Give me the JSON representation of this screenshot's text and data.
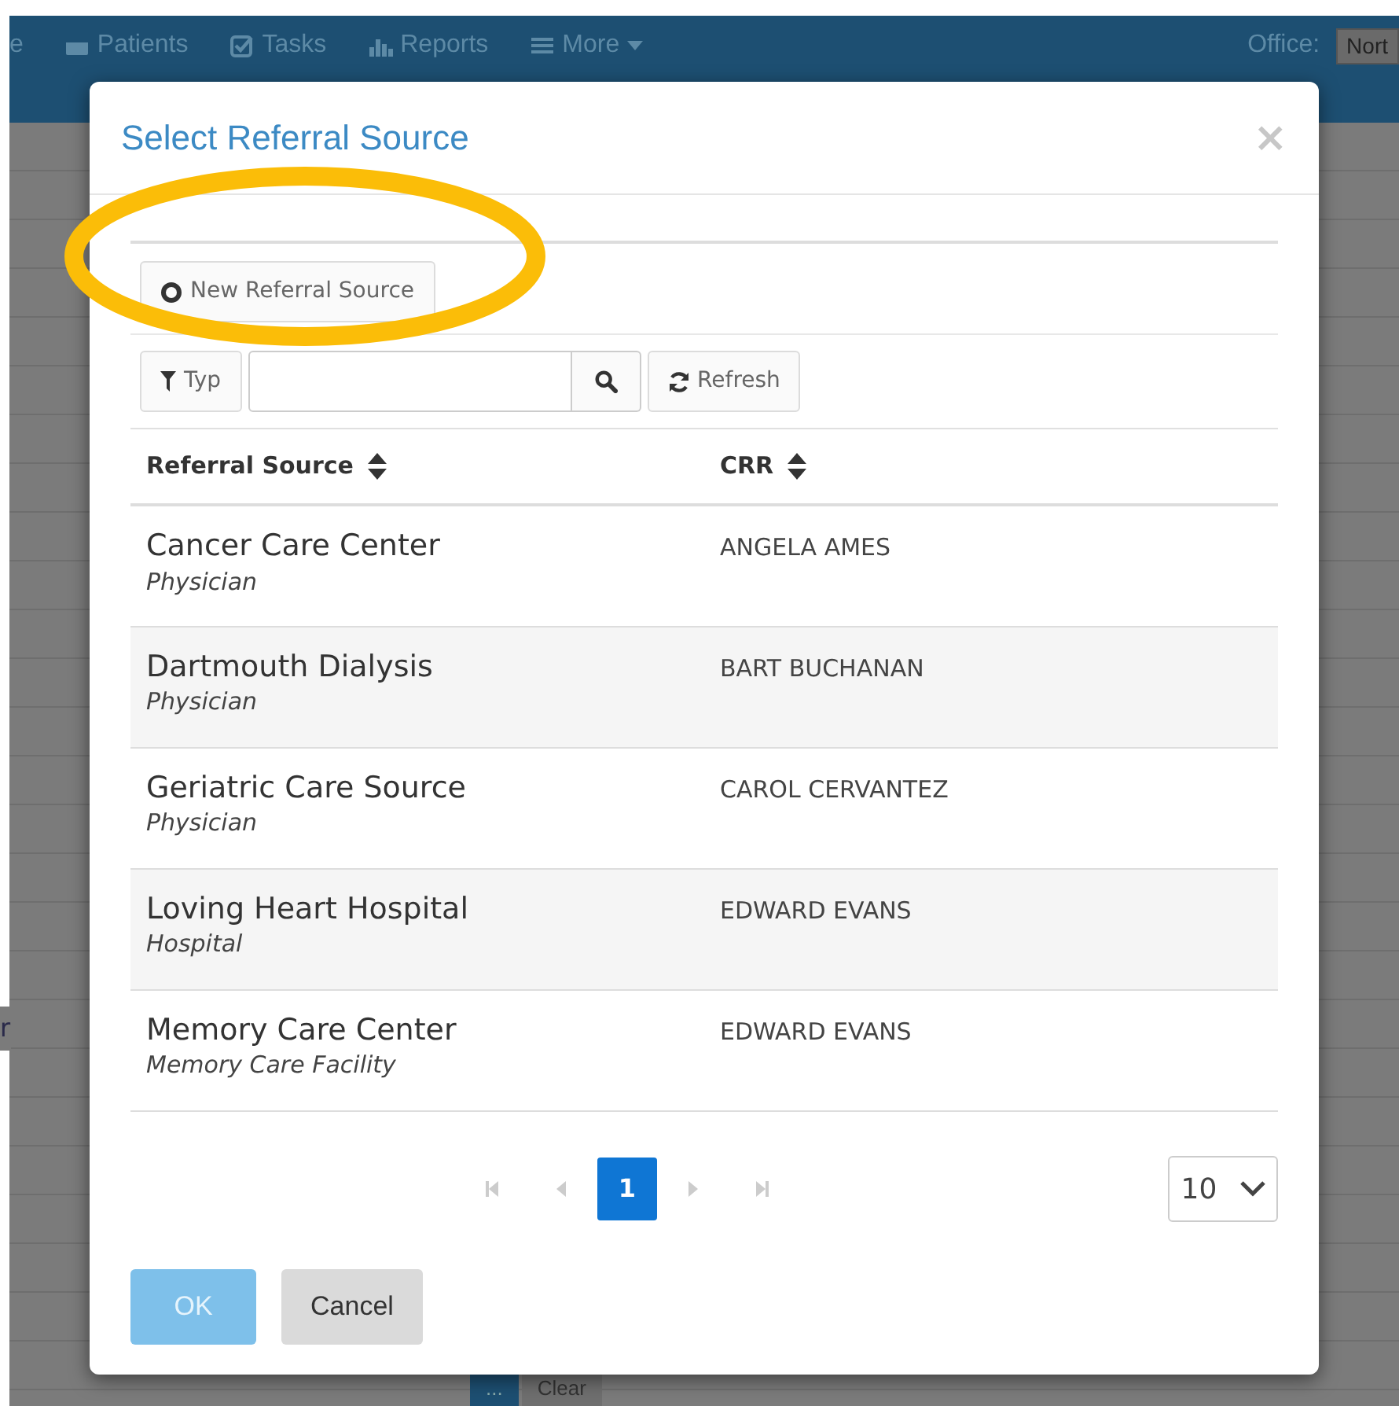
{
  "navbar": {
    "items": [
      {
        "label": "e"
      },
      {
        "label": "Patients"
      },
      {
        "label": "Tasks"
      },
      {
        "label": "Reports"
      },
      {
        "label": "More"
      }
    ],
    "office_label": "Office:",
    "office_value": "Nort"
  },
  "background": {
    "side_text": "r",
    "bottom_buttons": [
      "...",
      "Clear"
    ]
  },
  "dialog": {
    "title": "Select Referral Source",
    "close": "×",
    "new_button": "New Referral Source",
    "type_button": "Typ",
    "refresh_button": "Refresh",
    "table": {
      "columns": [
        "Referral Source",
        "CRR"
      ],
      "rows": [
        {
          "name": "Cancer Care Center",
          "type": "Physician",
          "crr": "ANGELA AMES"
        },
        {
          "name": "Dartmouth Dialysis",
          "type": "Physician",
          "crr": "BART BUCHANAN"
        },
        {
          "name": "Geriatric Care Source",
          "type": "Physician",
          "crr": "CAROL CERVANTEZ"
        },
        {
          "name": "Loving Heart Hospital",
          "type": "Hospital",
          "crr": "EDWARD EVANS"
        },
        {
          "name": "Memory Care Center",
          "type": "Memory Care Facility",
          "crr": "EDWARD EVANS"
        }
      ]
    },
    "pages": [
      {
        "label": "1",
        "selected": true
      }
    ],
    "page_size": "10",
    "buttons": [
      {
        "label": "OK",
        "disabled": true
      },
      {
        "label": "Cancel",
        "disabled": false
      }
    ]
  }
}
